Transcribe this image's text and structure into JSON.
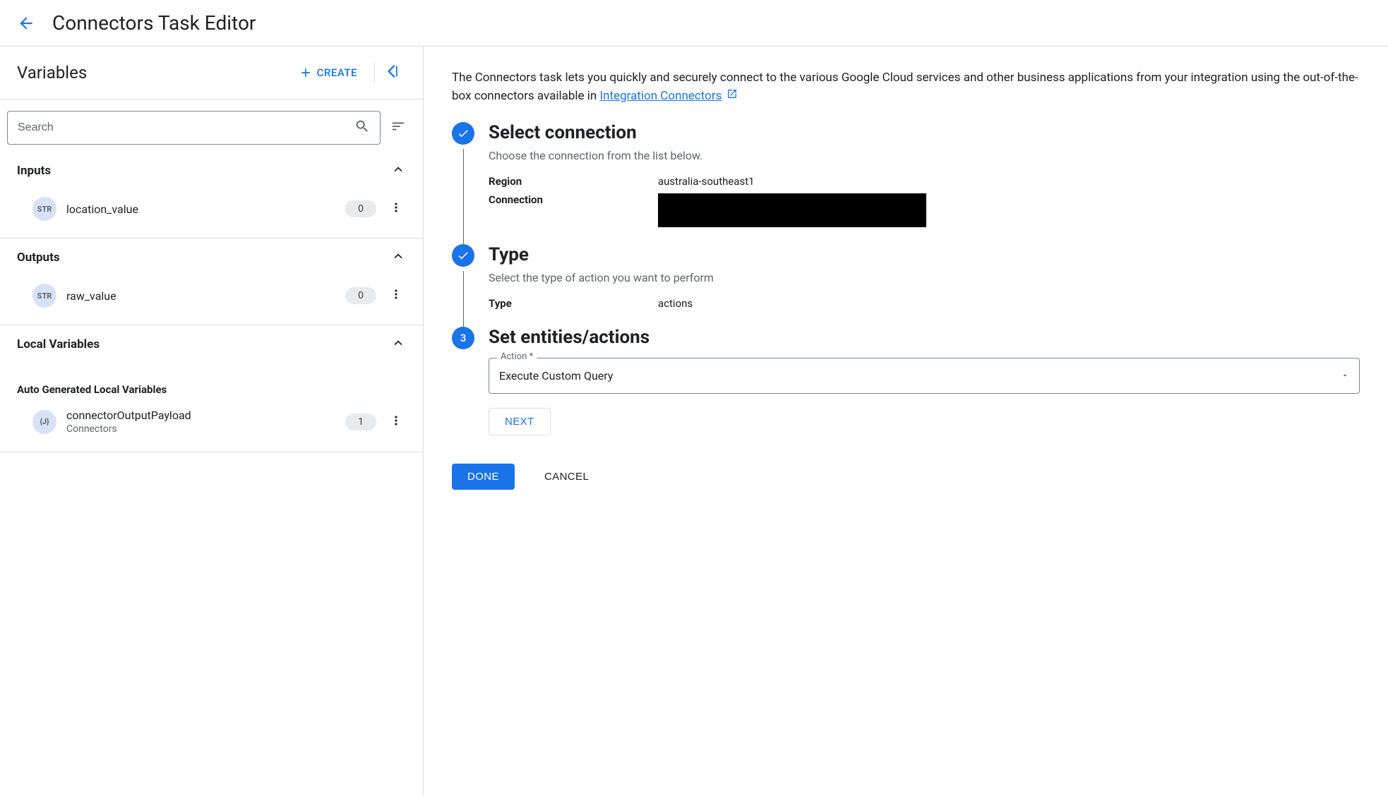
{
  "header": {
    "title": "Connectors Task Editor"
  },
  "leftPanel": {
    "title": "Variables",
    "create_label": "CREATE",
    "search_placeholder": "Search",
    "sections": {
      "inputs": {
        "title": "Inputs",
        "items": [
          {
            "type": "STR",
            "name": "location_value",
            "count": "0"
          }
        ]
      },
      "outputs": {
        "title": "Outputs",
        "items": [
          {
            "type": "STR",
            "name": "raw_value",
            "count": "0"
          }
        ]
      },
      "local": {
        "title": "Local Variables",
        "auto_title": "Auto Generated Local Variables",
        "items": [
          {
            "type": "{J}",
            "name": "connectorOutputPayload",
            "sub": "Connectors",
            "count": "1"
          }
        ]
      }
    }
  },
  "rightPanel": {
    "description_pre": "The Connectors task lets you quickly and securely connect to the various Google Cloud services and other business applications from your integration using the out-of-the-box connectors available in ",
    "description_link": "Integration Connectors",
    "steps": {
      "s1": {
        "title": "Select connection",
        "sub": "Choose the connection from the list below.",
        "region_label": "Region",
        "region_value": "australia-southeast1",
        "connection_label": "Connection"
      },
      "s2": {
        "title": "Type",
        "sub": "Select the type of action you want to perform",
        "type_label": "Type",
        "type_value": "actions"
      },
      "s3": {
        "num": "3",
        "title": "Set entities/actions",
        "action_label": "Action *",
        "action_value": "Execute Custom Query",
        "next_label": "NEXT"
      }
    },
    "done_label": "DONE",
    "cancel_label": "CANCEL"
  }
}
